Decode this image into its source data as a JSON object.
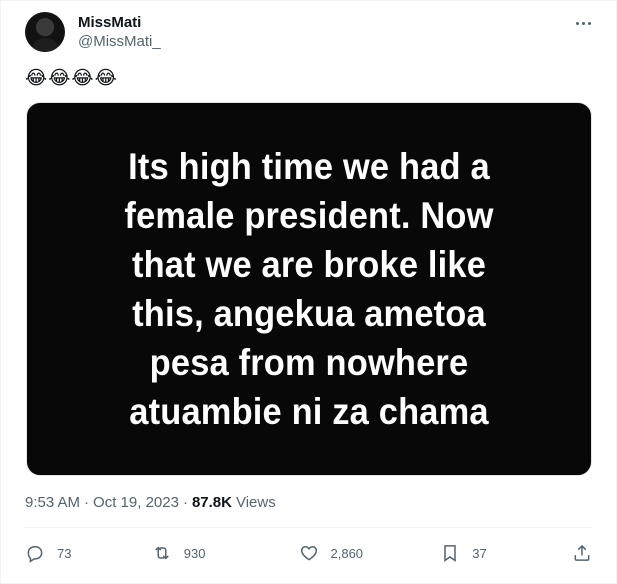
{
  "author": {
    "display_name": "MissMati",
    "handle": "@MissMati_"
  },
  "tweet": {
    "text": "😂😂😂😂",
    "media_text": "Its high time we had a female president. Now that we are broke like this, angekua ametoa pesa from nowhere atuambie ni za chama"
  },
  "meta": {
    "time": "9:53 AM",
    "separator1": "·",
    "date": "Oct 19, 2023",
    "separator2": "·",
    "views_count": "87.8K",
    "views_label": "Views"
  },
  "actions": {
    "replies": "73",
    "retweets": "930",
    "likes": "2,860",
    "bookmarks": "37"
  },
  "icons": {
    "more": "more-horizontal-icon",
    "reply": "reply-icon",
    "retweet": "retweet-icon",
    "like": "heart-icon",
    "bookmark": "bookmark-icon",
    "share": "share-icon"
  },
  "colors": {
    "text": "#0f1419",
    "secondary": "#536471",
    "media_bg": "#080808"
  }
}
